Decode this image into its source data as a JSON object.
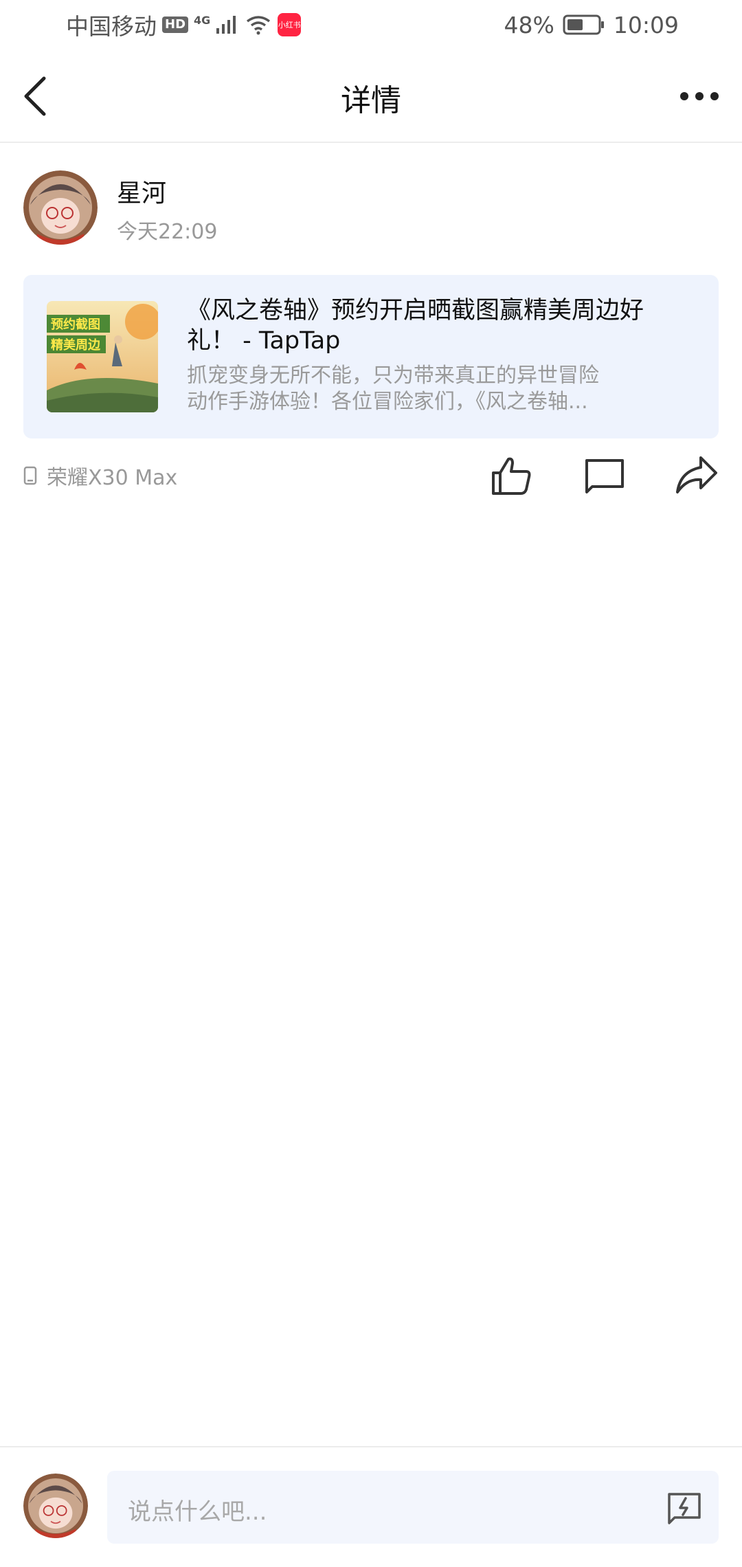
{
  "status_bar": {
    "carrier": "中国移动",
    "hd_badge": "HD",
    "network": "4G",
    "app_badge": "小红书",
    "battery": "48%",
    "time": "10:09"
  },
  "header": {
    "title": "详情"
  },
  "post": {
    "author_name": "星河",
    "time": "今天22:09",
    "card": {
      "title": "《风之卷轴》预约开启晒截图赢精美周边好礼！ - TapTap",
      "desc_line1": "抓宠变身无所不能，只为带来真正的异世冒险",
      "desc_line2": "动作手游体验！各位冒险家们，《风之卷轴...",
      "thumb_text_line1": "预约截图",
      "thumb_text_line2": "精美周边"
    },
    "device": "荣耀X30 Max"
  },
  "comment_box": {
    "placeholder": "说点什么吧..."
  },
  "colors": {
    "card_bg": "#eef3fd",
    "input_bg": "#f3f6fd",
    "app_badge": "#ff2442",
    "muted_text": "#999999"
  },
  "icons": [
    "back-arrow-icon",
    "more-icon",
    "device-icon",
    "like-icon",
    "comment-icon",
    "share-icon",
    "quick-reply-icon"
  ]
}
